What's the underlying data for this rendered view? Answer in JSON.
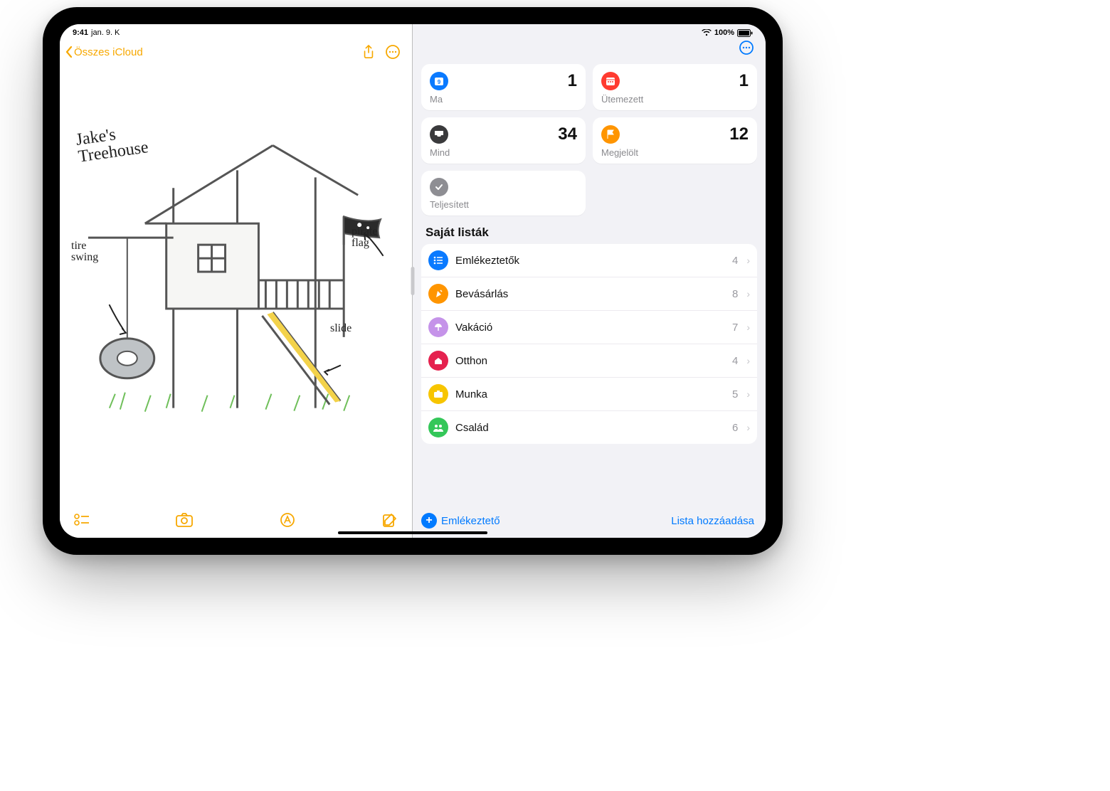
{
  "status": {
    "time": "9:41",
    "date": "jan. 9. K",
    "battery": "100%"
  },
  "notes": {
    "back_label": "Összes iCloud",
    "faint_title_1": "",
    "faint_title_2": "",
    "sketch": {
      "title": "Jake's",
      "title2": "Treehouse",
      "tire_swing": "tire\nswing",
      "pirate_flag": "pirate\nflag",
      "slide": "slide"
    }
  },
  "reminders": {
    "summary": [
      {
        "key": "today",
        "label": "Ma",
        "count": "1",
        "color": "#0a7aff",
        "glyph": "today"
      },
      {
        "key": "scheduled",
        "label": "Ütemezett",
        "count": "1",
        "color": "#ff3b30",
        "glyph": "calendar"
      },
      {
        "key": "all",
        "label": "Mind",
        "count": "34",
        "color": "#3a3a3c",
        "glyph": "tray"
      },
      {
        "key": "flagged",
        "label": "Megjelölt",
        "count": "12",
        "color": "#ff9500",
        "glyph": "flag"
      },
      {
        "key": "completed",
        "label": "Teljesített",
        "count": "",
        "color": "#8e8e93",
        "glyph": "check"
      }
    ],
    "section_title": "Saját listák",
    "lists": [
      {
        "name": "Emlékeztetők",
        "count": "4",
        "color": "#0a7aff",
        "glyph": "list"
      },
      {
        "name": "Bevásárlás",
        "count": "8",
        "color": "#ff9500",
        "glyph": "carrot"
      },
      {
        "name": "Vakáció",
        "count": "7",
        "color": "#c593e9",
        "glyph": "umbrella"
      },
      {
        "name": "Otthon",
        "count": "4",
        "color": "#e5224f",
        "glyph": "house"
      },
      {
        "name": "Munka",
        "count": "5",
        "color": "#f7c500",
        "glyph": "briefcase"
      },
      {
        "name": "Család",
        "count": "6",
        "color": "#34c759",
        "glyph": "people"
      }
    ],
    "add_reminder_label": "Emlékeztető",
    "add_list_label": "Lista hozzáadása"
  }
}
